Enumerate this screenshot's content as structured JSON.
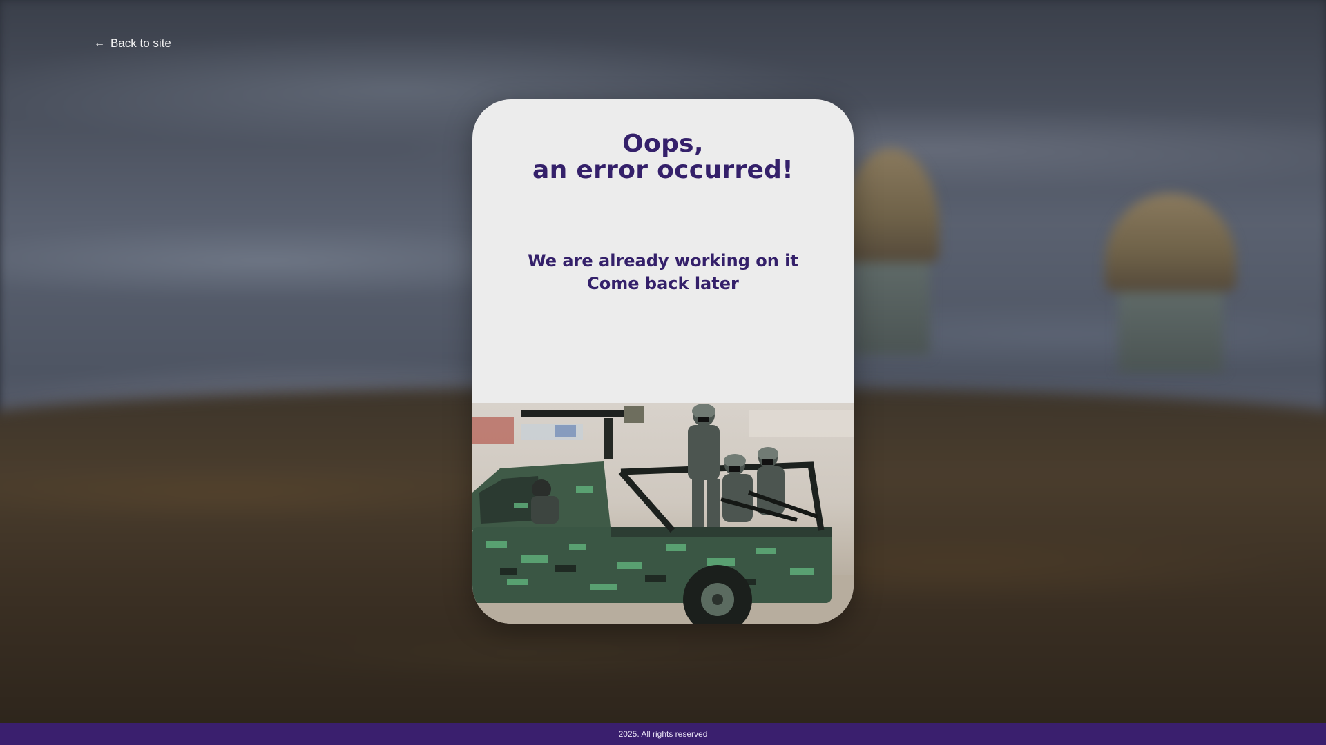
{
  "nav": {
    "back_label": "Back to site",
    "back_icon": "arrow-left-icon"
  },
  "card": {
    "title_line1": "Oops,",
    "title_line2": "an error occurred!",
    "message_line1": "We are already working on it",
    "message_line2": "Come back later",
    "title_color": "#34206a",
    "background": "#ececec"
  },
  "footer": {
    "copyright": "2025. All rights reserved",
    "background": "#3a1f6e"
  }
}
